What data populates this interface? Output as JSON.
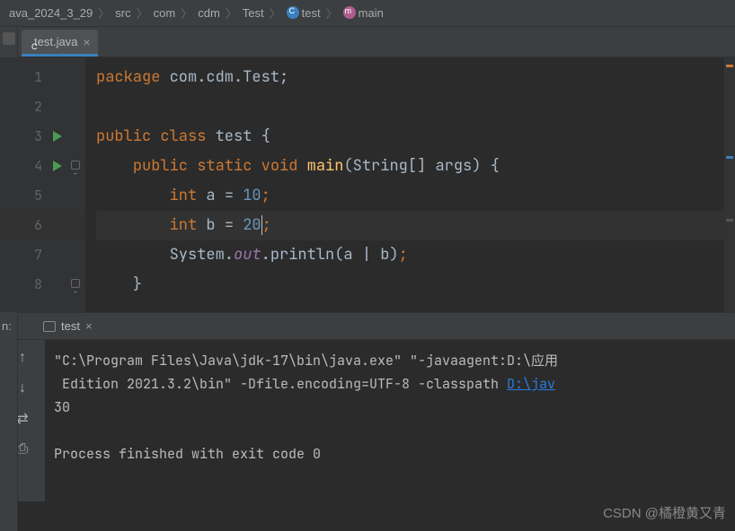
{
  "breadcrumb": {
    "items": [
      "ava_2024_3_29",
      "src",
      "com",
      "cdm",
      "Test",
      "test",
      "main"
    ],
    "icons": [
      "",
      "",
      "",
      "",
      "",
      "file",
      "method"
    ]
  },
  "tab": {
    "label": "test.java"
  },
  "run_panel_label": "n:",
  "lines": {
    "1": "1",
    "2": "2",
    "3": "3",
    "4": "4",
    "5": "5",
    "6": "6",
    "7": "7",
    "8": "8"
  },
  "code": {
    "l1": {
      "kw1": "package",
      "rest": " com.cdm.Test;",
      "semi": ""
    },
    "l3": {
      "kw1": "public",
      "kw2": "class",
      "name": "test",
      "brace": " {"
    },
    "l4": {
      "kw1": "public",
      "kw2": "static",
      "kw3": "void",
      "fn": "main",
      "params": "(String[] args) {",
      "indent": "    "
    },
    "l5": {
      "indent": "        ",
      "kw": "int",
      "var": " a ",
      "eq": "= ",
      "num": "10",
      "semi": ";"
    },
    "l6": {
      "indent": "        ",
      "kw": "int",
      "var": " b ",
      "eq": "= ",
      "num": "20",
      "semi": ";"
    },
    "l7": {
      "indent": "        ",
      "sys": "System.",
      "out": "out",
      "println": ".println(a | b)",
      "semi": ";"
    },
    "l8": {
      "indent": "    ",
      "brace": "}"
    }
  },
  "run_tab": {
    "label": "test"
  },
  "console": {
    "line1a": "\"C:\\Program Files\\Java\\jdk-17\\bin\\java.exe\" \"-javaagent:D:\\应用",
    "line1b": " Edition 2021.3.2\\bin\" -Dfile.encoding=UTF-8 -classpath ",
    "link": "D:\\jav",
    "output": "30",
    "exit": "Process finished with exit code 0"
  },
  "watermark": "CSDN @橘橙黄又青"
}
